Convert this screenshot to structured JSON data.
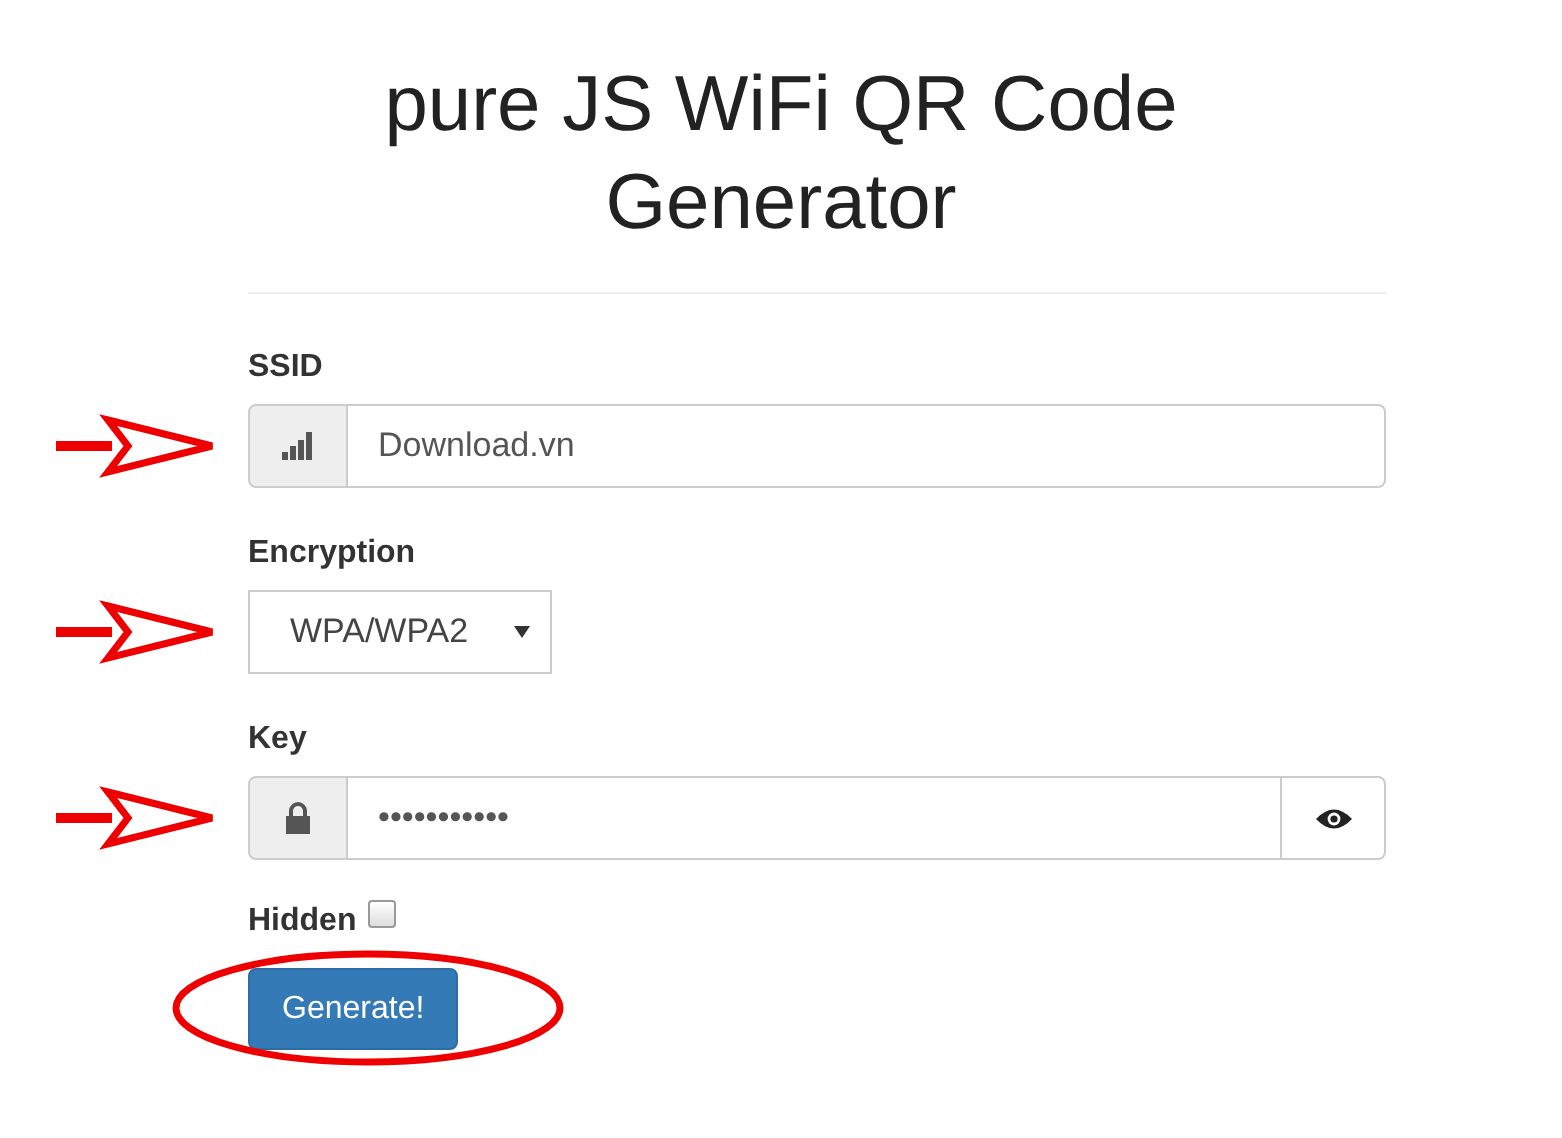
{
  "title": "pure JS WiFi QR Code Generator",
  "fields": [
    {
      "kind": "text",
      "label": "SSID",
      "value": "Download.vn"
    },
    {
      "kind": "select",
      "label": "Encryption",
      "value": "WPA/WPA2"
    },
    {
      "kind": "password",
      "label": "Key",
      "value": "•••••••••••"
    }
  ],
  "hidden": {
    "label": "Hidden",
    "checked": false
  },
  "button": "Generate!"
}
